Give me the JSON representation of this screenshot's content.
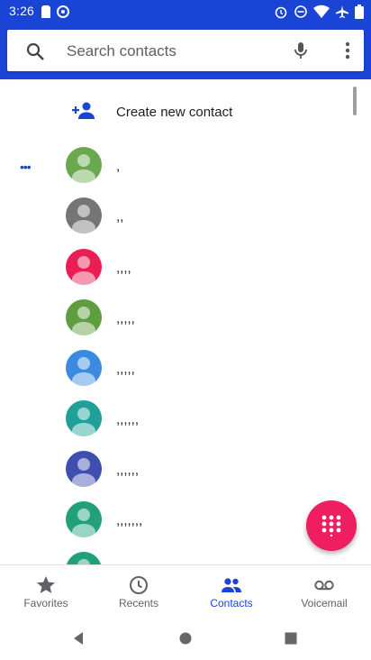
{
  "status": {
    "time": "3:26"
  },
  "search": {
    "placeholder": "Search contacts"
  },
  "create_contact": {
    "label": "Create new contact"
  },
  "contacts": [
    {
      "name": ",",
      "avatar_color": "#6aa84f"
    },
    {
      "name": ",,",
      "avatar_color": "#757575"
    },
    {
      "name": ",,,,",
      "avatar_color": "#e91e53"
    },
    {
      "name": ",,,,,",
      "avatar_color": "#5e9e3e"
    },
    {
      "name": ",,,,,",
      "avatar_color": "#3c8ae0"
    },
    {
      "name": ",,,,,,",
      "avatar_color": "#20a098"
    },
    {
      "name": ",,,,,,",
      "avatar_color": "#3e4fb0"
    },
    {
      "name": ",,,,,,,",
      "avatar_color": "#22a079"
    },
    {
      "name": "",
      "avatar_color": "#22a079"
    }
  ],
  "nav": {
    "favorites": "Favorites",
    "recents": "Recents",
    "contacts": "Contacts",
    "voicemail": "Voicemail"
  },
  "colors": {
    "primary": "#1a44d6",
    "fab": "#ef1e60"
  }
}
